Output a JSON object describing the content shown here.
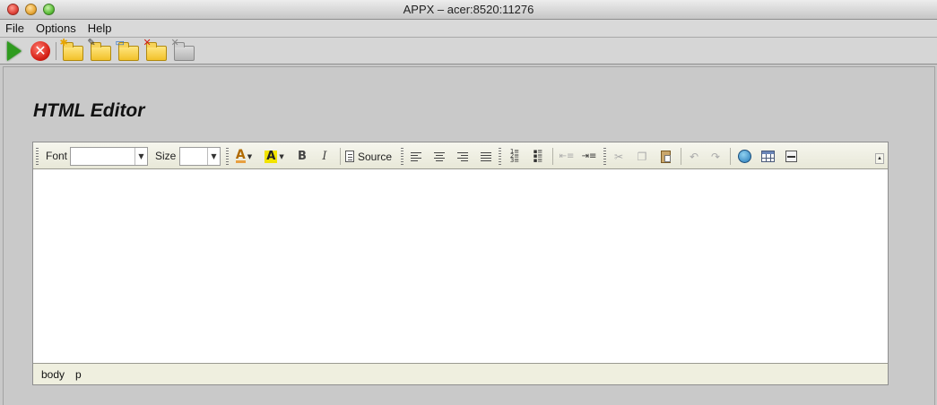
{
  "window": {
    "title": "APPX – acer:8520:11276"
  },
  "menubar": {
    "items": [
      "File",
      "Options",
      "Help"
    ]
  },
  "toolbar": {
    "buttons": [
      {
        "name": "run-button",
        "icon": "play-icon"
      },
      {
        "name": "stop-button",
        "icon": "stop-icon"
      },
      {
        "name": "new-folder-button",
        "icon": "folder-new-icon"
      },
      {
        "name": "edit-folder-button",
        "icon": "folder-edit-icon"
      },
      {
        "name": "open-folder-button",
        "icon": "folder-open-icon"
      },
      {
        "name": "delete-folder-button",
        "icon": "folder-delete-icon"
      },
      {
        "name": "disabled-folder-button",
        "icon": "folder-disabled-icon"
      }
    ]
  },
  "page": {
    "heading": "HTML Editor"
  },
  "editor": {
    "font_label": "Font",
    "font_value": "",
    "size_label": "Size",
    "size_value": "",
    "source_label": "Source",
    "bold_glyph": "B",
    "italic_glyph": "I",
    "text_color_glyph": "A",
    "bg_color_glyph": "A",
    "status_path": [
      "body",
      "p"
    ],
    "content": ""
  },
  "colors": {
    "window_bg": "#c9c9c9",
    "editor_toolbar_bg": "#efefdf",
    "play_green": "#2f9b1f",
    "stop_red": "#d41e14",
    "folder_yellow": "#f2c12a"
  }
}
